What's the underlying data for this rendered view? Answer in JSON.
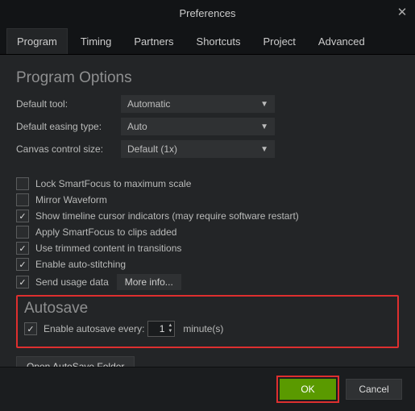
{
  "window": {
    "title": "Preferences"
  },
  "tabs": {
    "program": "Program",
    "timing": "Timing",
    "partners": "Partners",
    "shortcuts": "Shortcuts",
    "project": "Project",
    "advanced": "Advanced"
  },
  "section": {
    "program_options": "Program Options",
    "autosave": "Autosave"
  },
  "fields": {
    "default_tool": {
      "label": "Default tool:",
      "value": "Automatic"
    },
    "default_easing": {
      "label": "Default easing type:",
      "value": "Auto"
    },
    "canvas_size": {
      "label": "Canvas control size:",
      "value": "Default (1x)"
    }
  },
  "checkboxes": {
    "lock_smartfocus": {
      "label": "Lock SmartFocus to maximum scale",
      "checked": false
    },
    "mirror_waveform": {
      "label": "Mirror Waveform",
      "checked": false
    },
    "show_cursor": {
      "label": "Show timeline cursor indicators (may require software restart)",
      "checked": true
    },
    "apply_smartfocus": {
      "label": "Apply SmartFocus to clips added",
      "checked": false
    },
    "use_trimmed": {
      "label": "Use trimmed content in transitions",
      "checked": true
    },
    "auto_stitch": {
      "label": "Enable auto-stitching",
      "checked": true
    },
    "usage_data": {
      "label": "Send usage data",
      "checked": true
    },
    "enable_autosave": {
      "label": "Enable autosave every:",
      "checked": true
    }
  },
  "autosave": {
    "value": "1",
    "unit": "minute(s)"
  },
  "buttons": {
    "more_info": "More info...",
    "open_folder": "Open AutoSave Folder",
    "ok": "OK",
    "cancel": "Cancel"
  }
}
